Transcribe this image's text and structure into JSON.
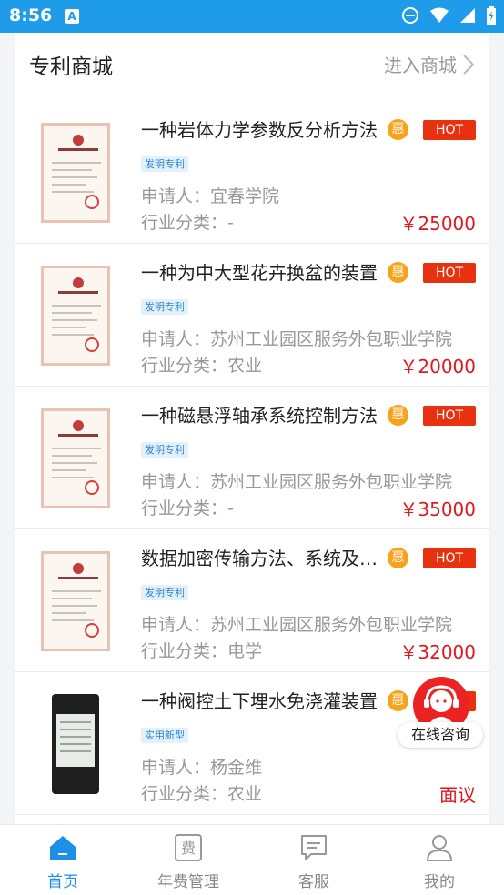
{
  "status_bar": {
    "time": "8:56",
    "notification_icon": "A"
  },
  "header": {
    "title": "专利商城",
    "link_label": "进入商城"
  },
  "badges": {
    "discount": "惠",
    "hot": "HOT"
  },
  "items": [
    {
      "title": "一种岩体力学参数反分析方法",
      "tag": "发明专利",
      "applicant": "申请人：宜春学院",
      "category": "行业分类：-",
      "price": "￥25000",
      "hot": true,
      "thumb": "certificate"
    },
    {
      "title": "一种为中大型花卉换盆的装置",
      "tag": "发明专利",
      "applicant": "申请人：苏州工业园区服务外包职业学院",
      "category": "行业分类：农业",
      "price": "￥20000",
      "hot": true,
      "thumb": "certificate"
    },
    {
      "title": "一种磁悬浮轴承系统控制方法",
      "tag": "发明专利",
      "applicant": "申请人：苏州工业园区服务外包职业学院",
      "category": "行业分类：-",
      "price": "￥35000",
      "hot": true,
      "thumb": "certificate"
    },
    {
      "title": "数据加密传输方法、系统及装置",
      "tag": "发明专利",
      "applicant": "申请人：苏州工业园区服务外包职业学院",
      "category": "行业分类：电学",
      "price": "￥32000",
      "hot": true,
      "thumb": "certificate"
    },
    {
      "title": "一种阀控土下埋水免浇灌装置",
      "tag": "实用新型",
      "applicant": "申请人：杨金维",
      "category": "行业分类：农业",
      "price": "面议",
      "hot": true,
      "thumb": "phone"
    }
  ],
  "float_button": {
    "label": "在线咨询"
  },
  "tabs": [
    {
      "label": "首页",
      "icon": "home-icon",
      "active": true
    },
    {
      "label": "年费管理",
      "icon": "fee-icon",
      "active": false
    },
    {
      "label": "客服",
      "icon": "chat-icon",
      "active": false
    },
    {
      "label": "我的",
      "icon": "user-icon",
      "active": false
    }
  ],
  "colors": {
    "status_bar": "#1e9be9",
    "accent": "#1c8fe6",
    "price": "#e0171e",
    "hot": "#e8320f",
    "discount": "#f8a21a"
  }
}
